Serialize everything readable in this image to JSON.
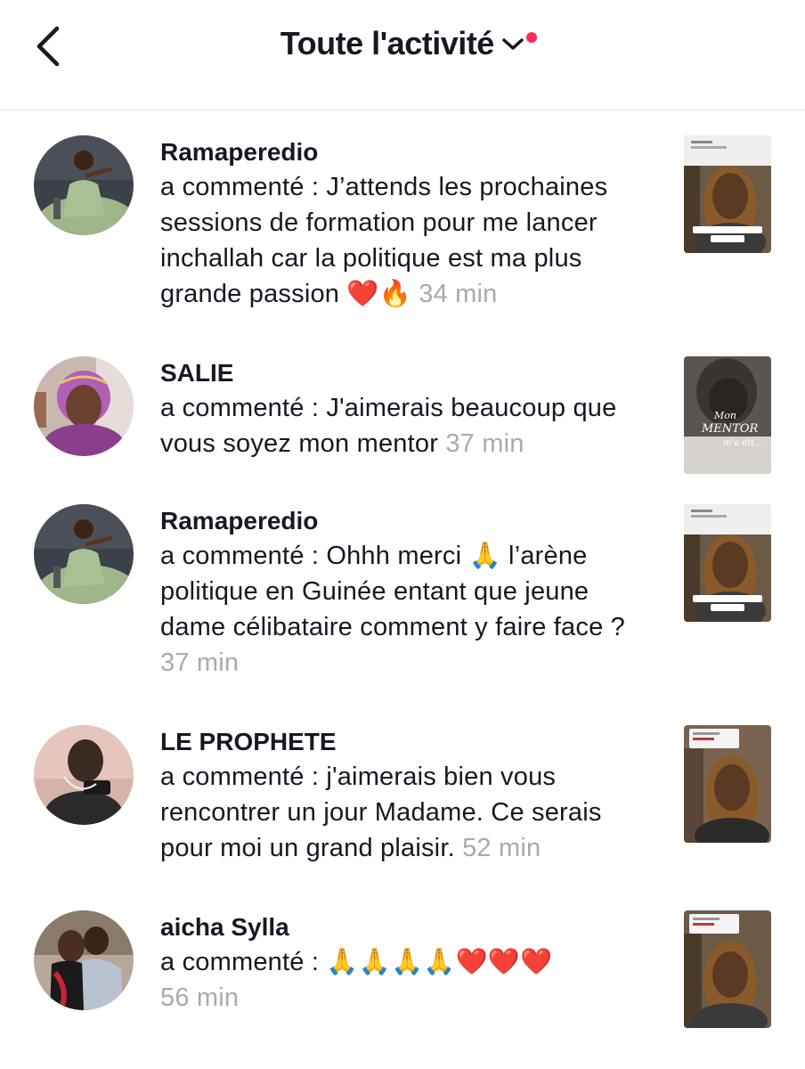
{
  "header": {
    "title": "Toute l'activité",
    "unread_dot_color": "#fe2c55",
    "back_icon": "chevron-left-icon",
    "dropdown_icon": "chevron-down-icon"
  },
  "activities": [
    {
      "username": "Ramaperedio",
      "text": "a commenté : J’attends les prochaines sessions de formation pour me lancer inchallah car la politique est ma plus grande passion ❤️🔥",
      "time": "34 min"
    },
    {
      "username": "SALIE",
      "text": "a commenté : J'aimerais beaucoup que vous soyez mon mentor",
      "time": "37 min",
      "thumbnail_text": [
        "Mon",
        "MENTOR",
        "m'a dit..."
      ]
    },
    {
      "username": "Ramaperedio",
      "text": "a commenté : Ohhh merci 🙏 l’arène politique en Guinée entant que jeune dame célibataire comment y faire face ?",
      "time": "37 min"
    },
    {
      "username": "LE PROPHETE",
      "text": "a commenté : j'aimerais bien vous rencontrer un jour Madame. Ce serais pour moi un grand plaisir.",
      "time": "52 min"
    },
    {
      "username": "aicha Sylla",
      "text": "a commenté : 🙏🙏🙏🙏❤️❤️❤️",
      "time": "56 min"
    }
  ]
}
